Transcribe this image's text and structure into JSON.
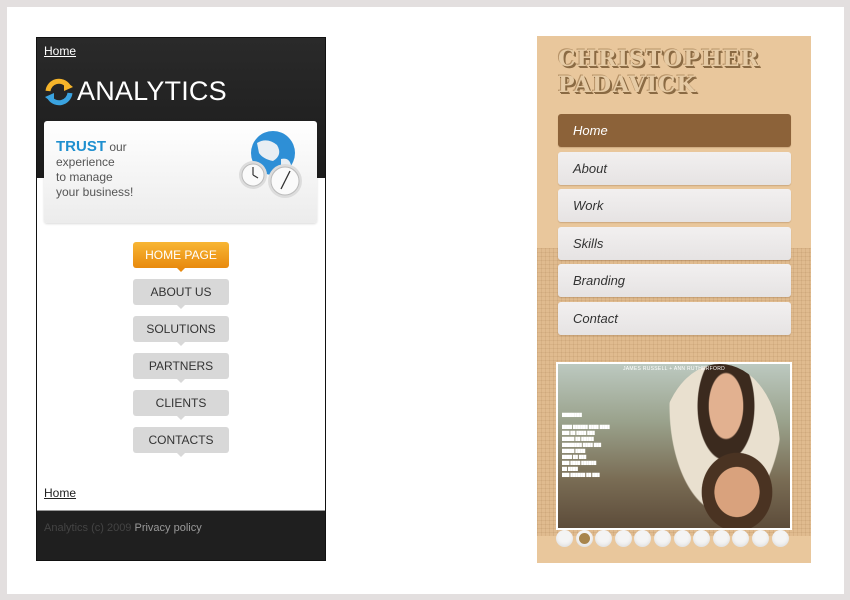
{
  "analytics_site": {
    "top_link": "Home",
    "logo_text": "ANALYTICS",
    "logo_icon": "refresh-arrows-icon",
    "banner": {
      "highlight": "TRUST",
      "line1_rest": " our",
      "line2": "experience",
      "line3": "to manage",
      "line4": "your business!",
      "illustration": "globe-clocks-icon"
    },
    "nav": [
      {
        "label": "HOME PAGE",
        "active": true
      },
      {
        "label": "ABOUT US",
        "active": false
      },
      {
        "label": "SOLUTIONS",
        "active": false
      },
      {
        "label": "PARTNERS",
        "active": false
      },
      {
        "label": "CLIENTS",
        "active": false
      },
      {
        "label": "CONTACTS",
        "active": false
      }
    ],
    "bottom_link": "Home",
    "footer": {
      "copyright": "Analytics (c) 2009 ",
      "privacy_link": "Privacy policy"
    },
    "colors": {
      "accent_orange": "#f0a020",
      "accent_blue": "#1e8fcf",
      "header_bg": "#1f1f1f"
    }
  },
  "portfolio_site": {
    "title_line1": "CHRISTOPHER",
    "title_line2": "PADAVICK",
    "nav": [
      {
        "label": "Home",
        "active": true
      },
      {
        "label": "About",
        "active": false
      },
      {
        "label": "Work",
        "active": false
      },
      {
        "label": "Skills",
        "active": false
      },
      {
        "label": "Branding",
        "active": false
      },
      {
        "label": "Contact",
        "active": false
      }
    ],
    "slideshow": {
      "caption": "JAMES RUSSELL + ANN RUTHERFORD",
      "slide_count": 12,
      "active_slide": 2
    },
    "colors": {
      "bg": "#e9c79c",
      "active_nav": "#8c6239",
      "active_dot": "#a8854c"
    }
  }
}
